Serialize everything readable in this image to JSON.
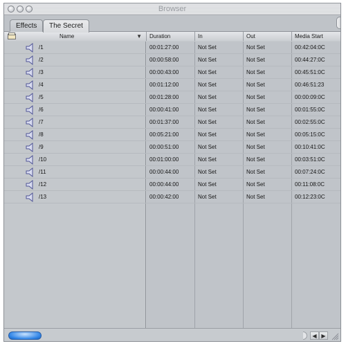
{
  "window": {
    "title": "Browser"
  },
  "tabs": [
    {
      "label": "Effects"
    },
    {
      "label": "The Secret"
    }
  ],
  "columns": {
    "name": "Name",
    "duration": "Duration",
    "in": "In",
    "out": "Out",
    "media_start": "Media Start"
  },
  "sort_indicator": "▼",
  "rows": [
    {
      "name": "/1",
      "duration": "00:01:27:00",
      "in": "Not Set",
      "out": "Not Set",
      "media_start": "00:42:04:0C"
    },
    {
      "name": "/2",
      "duration": "00:00:58:00",
      "in": "Not Set",
      "out": "Not Set",
      "media_start": "00:44:27:0C"
    },
    {
      "name": "/3",
      "duration": "00:00:43:00",
      "in": "Not Set",
      "out": "Not Set",
      "media_start": "00:45:51:0C"
    },
    {
      "name": "/4",
      "duration": "00:01:12:00",
      "in": "Not Set",
      "out": "Not Set",
      "media_start": "00:46:51:23"
    },
    {
      "name": "/5",
      "duration": "00:01:28:00",
      "in": "Not Set",
      "out": "Not Set",
      "media_start": "00:00:09:0C"
    },
    {
      "name": "/6",
      "duration": "00:00:41:00",
      "in": "Not Set",
      "out": "Not Set",
      "media_start": "00:01:55:0C"
    },
    {
      "name": "/7",
      "duration": "00:01:37:00",
      "in": "Not Set",
      "out": "Not Set",
      "media_start": "00:02:55:0C"
    },
    {
      "name": "/8",
      "duration": "00:05:21:00",
      "in": "Not Set",
      "out": "Not Set",
      "media_start": "00:05:15:0C"
    },
    {
      "name": "/9",
      "duration": "00:00:51:00",
      "in": "Not Set",
      "out": "Not Set",
      "media_start": "00:10:41:0C"
    },
    {
      "name": "/10",
      "duration": "00:01:00:00",
      "in": "Not Set",
      "out": "Not Set",
      "media_start": "00:03:51:0C"
    },
    {
      "name": "/11",
      "duration": "00:00:44:00",
      "in": "Not Set",
      "out": "Not Set",
      "media_start": "00:07:24:0C"
    },
    {
      "name": "/12",
      "duration": "00:00:44:00",
      "in": "Not Set",
      "out": "Not Set",
      "media_start": "00:11:08:0C"
    },
    {
      "name": "/13",
      "duration": "00:00:42:00",
      "in": "Not Set",
      "out": "Not Set",
      "media_start": "00:12:23:0C"
    }
  ],
  "icons": {
    "row_icon": "audio-speaker-icon",
    "header_icon": "bin-icon"
  },
  "scrollbar": {
    "left_arrow": "◀",
    "right_arrow": "▶"
  }
}
